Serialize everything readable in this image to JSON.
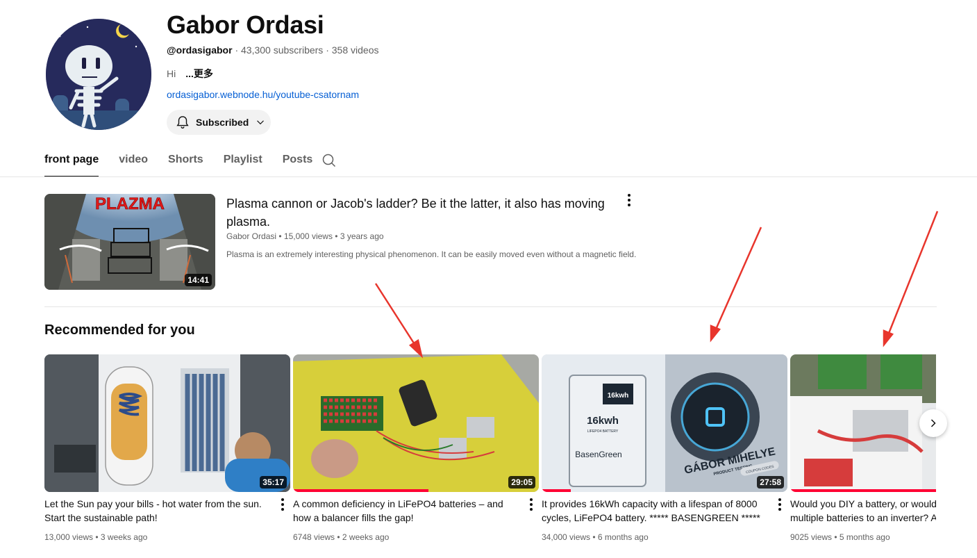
{
  "channel": {
    "name": "Gabor Ordasi",
    "handle": "@ordasigabor",
    "subscribers": "43,300 subscribers",
    "videos": "358 videos",
    "description": "Hi",
    "more_label": "...更多",
    "link": "ordasigabor.webnode.hu/youtube-csatornam",
    "subscribe_label": "Subscribed"
  },
  "tabs": [
    {
      "label": "front page"
    },
    {
      "label": "video"
    },
    {
      "label": "Shorts"
    },
    {
      "label": "Playlist"
    },
    {
      "label": "Posts"
    }
  ],
  "featured": {
    "thumb_text": "PLAZMA",
    "duration": "14:41",
    "title": "Plasma cannon or Jacob's ladder? Be it the latter, it also has moving plasma.",
    "author": "Gabor Ordasi",
    "views": "15,000 views",
    "age": "3 years ago",
    "description": "Plasma is an extremely interesting physical phenomenon. It can be easily moved even without a magnetic field."
  },
  "recommended": {
    "heading": "Recommended for you",
    "videos": [
      {
        "title": "Let the Sun pay your bills - hot water from the sun. Start the sustainable path!",
        "views": "13,000 views",
        "age": "3 weeks ago",
        "duration": "35:17"
      },
      {
        "title": "A common deficiency in LiFePO4 batteries – and how a balancer fills the gap!",
        "views": "6748 views",
        "age": "2 weeks ago",
        "duration": "29:05",
        "progress": 0.55
      },
      {
        "title": "It provides 16kWh capacity with a lifespan of 8000 cycles, LiFePO4 battery. ***** BASENGREEN *****",
        "views": "34,000 views",
        "age": "6 months ago",
        "duration": "27:58",
        "progress": 0.12,
        "thumb_texts": [
          "16kwh",
          "LIFEPO4 BATTERY",
          "BasenGreen",
          "GÁBOR MIHELYE",
          "PRODUCT TESTING",
          "COUPON CODES"
        ]
      },
      {
        "title": "Would you DIY a battery, or would you connect multiple batteries to an inverter? A",
        "views": "9025 views",
        "age": "5 months ago",
        "progress": 0.6
      }
    ]
  },
  "separator": " • ",
  "dot_separator": " · "
}
